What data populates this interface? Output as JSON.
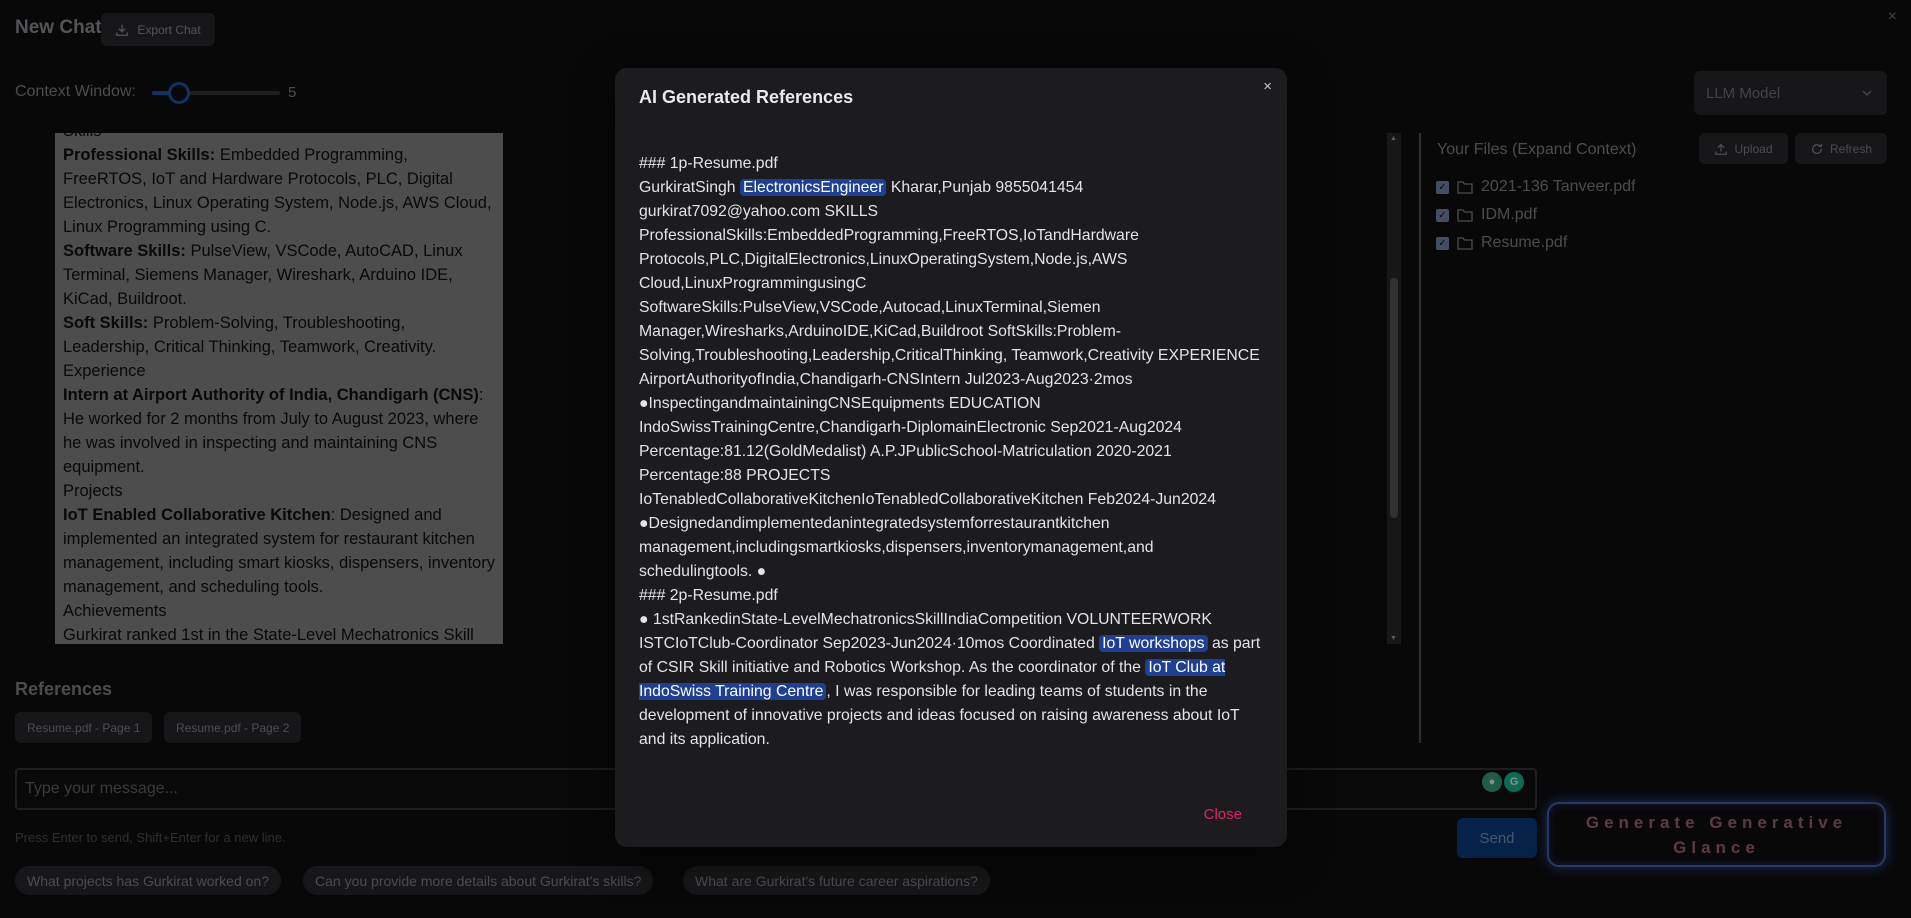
{
  "app": {
    "title": "New Chat",
    "export_label": "Export Chat",
    "window_close": "×"
  },
  "context_window": {
    "label": "Context Window:",
    "value": "5",
    "level": 0.2
  },
  "llm_select": {
    "placeholder": "LLM Model"
  },
  "chat": {
    "cut_top": "Skills",
    "lines": [
      {
        "bold": "Professional Skills:",
        "text": " Embedded Programming, FreeRTOS, IoT and Hardware Protocols, PLC, Digital Electronics, Linux Operating System, Node.js, AWS Cloud, Linux Programming using C."
      },
      {
        "bold": "Software Skills:",
        "text": " PulseView, VSCode, AutoCAD, Linux Terminal, Siemens Manager, Wireshark, Arduino IDE, KiCad, Buildroot."
      },
      {
        "bold": "Soft Skills:",
        "text": " Problem-Solving, Troubleshooting, Leadership, Critical Thinking, Teamwork, Creativity."
      },
      {
        "bold": "",
        "text": "Experience"
      },
      {
        "bold": "Intern at Airport Authority of India, Chandigarh (CNS)",
        "text": ": He worked for 2 months from July to August 2023, where he was involved in inspecting and maintaining CNS equipment."
      },
      {
        "bold": "",
        "text": "Projects"
      },
      {
        "bold": "IoT Enabled Collaborative Kitchen",
        "text": ": Designed and implemented an integrated system for restaurant kitchen management, including smart kiosks, dispensers, inventory management, and scheduling tools."
      },
      {
        "bold": "",
        "text": "Achievements"
      },
      {
        "bold": "",
        "text": "Gurkirat ranked 1st in the State-Level Mechatronics Skill"
      }
    ]
  },
  "files": {
    "title": "Your Files (Expand Context)",
    "upload_label": "Upload",
    "refresh_label": "Refresh",
    "items": [
      "2021-136 Tanveer.pdf",
      "IDM.pdf",
      "Resume.pdf"
    ]
  },
  "references": {
    "title": "References",
    "chips": [
      "Resume.pdf - Page 1",
      "Resume.pdf - Page 2"
    ]
  },
  "composer": {
    "placeholder": "Type your message...",
    "hint": "Press Enter to send, Shift+Enter for a new line.",
    "send_label": "Send",
    "glance_line1": "Generate Generative",
    "glance_line2": "Glance"
  },
  "suggestions": [
    "What projects has Gurkirat worked on?",
    "Can you provide more details about Gurkirat's skills?",
    "What are Gurkirat's future career aspirations?"
  ],
  "modal": {
    "title": "AI Generated References",
    "close_x": "×",
    "close_label": "Close",
    "p1_heading": "### 1p-Resume.pdf",
    "p1_name": "GurkiratSingh",
    "p1_hl1": "ElectronicsEngineer",
    "p1_rest": "Kharar,Punjab 9855041454 gurkirat7092@yahoo.com SKILLS ProfessionalSkills:EmbeddedProgramming,FreeRTOS,IoTandHardware Protocols,PLC,DigitalElectronics,LinuxOperatingSystem,Node.js,AWS Cloud,LinuxProgrammingusingC SoftwareSkills:PulseView,VSCode,Autocad,LinuxTerminal,Siemen Manager,Wiresharks,ArduinoIDE,KiCad,Buildroot SoftSkills:Problem-Solving,Troubleshooting,Leadership,CriticalThinking, Teamwork,Creativity EXPERIENCE AirportAuthorityofIndia,Chandigarh-CNSIntern Jul2023-Aug2023·2mos ●InspectingandmaintainingCNSEquipments EDUCATION IndoSwissTrainingCentre,Chandigarh-DiplomainElectronic Sep2021-Aug2024 Percentage:81.12(GoldMedalist) A.P.JPublicSchool-Matriculation 2020-2021 Percentage:88 PROJECTS IoTenabledCollaborativeKitchenIoTenabledCollaborativeKitchen Feb2024-Jun2024 ●Designedandimplementedanintegratedsystemforrestaurantkitchen management,includingsmartkiosks,dispensers,inventorymanagement,and schedulingtools. ●",
    "p2_heading": "### 2p-Resume.pdf",
    "p2_start": "● 1stRankedinState-LevelMechatronicsSkillIndiaCompetition VOLUNTEERWORK ISTCIoTClub-Coordinator Sep2023-Jun2024·10mos Coordinated",
    "p2_hl1": "IoT workshops",
    "p2_mid": "as part of CSIR Skill initiative and Robotics Workshop. As the coordinator of the",
    "p2_hl2": "IoT Club at IndoSwiss Training Centre",
    "p2_end": ", I was responsible for leading teams of students in the development of innovative projects and ideas focused on raising awareness about IoT and its application."
  }
}
